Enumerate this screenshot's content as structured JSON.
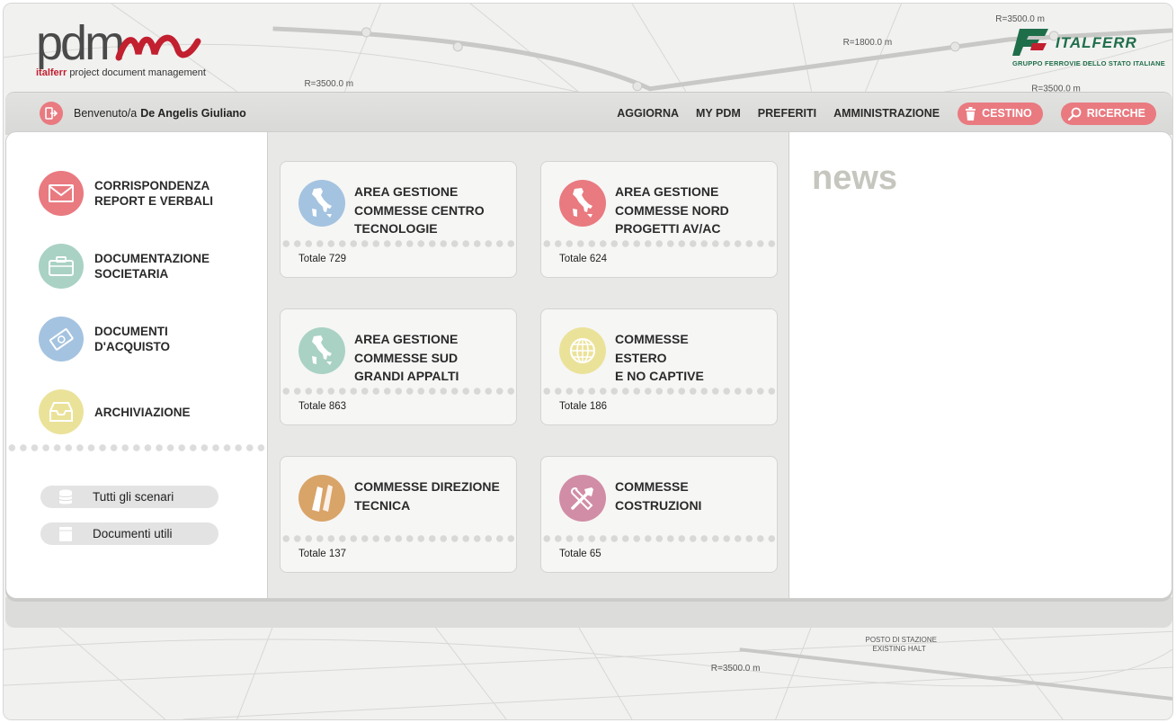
{
  "header": {
    "logo_text": "pdm",
    "logo_brand": "italferr",
    "logo_subtitle": "project document management",
    "company_name": "ITALFERR",
    "company_subtitle": "GRUPPO FERROVIE DELLO STATO ITALIANE"
  },
  "topbar": {
    "welcome_prefix": "Benvenuto/a",
    "user_name": "De Angelis Giuliano",
    "nav": [
      "AGGIORNA",
      "MY PDM",
      "PREFERITI",
      "AMMINISTRAZIONE"
    ],
    "trash_label": "CESTINO",
    "search_label": "RICERCHE"
  },
  "sidebar": {
    "categories": [
      {
        "label": "CORRISPONDENZA\nREPORT E VERBALI",
        "icon": "envelope-icon",
        "color": "#e97a80"
      },
      {
        "label": "DOCUMENTAZIONE\nSOCIETARIA",
        "icon": "briefcase-icon",
        "color": "#a9d2c4"
      },
      {
        "label": "DOCUMENTI\nD'ACQUISTO",
        "icon": "banknote-icon",
        "color": "#a4c3e0"
      },
      {
        "label": "ARCHIVIAZIONE",
        "icon": "inbox-tray-icon",
        "color": "#ebe29a"
      }
    ],
    "buttons": [
      "Tutti gli scenari",
      "Documenti utili"
    ]
  },
  "areas": [
    {
      "title": "AREA GESTIONE\nCOMMESSE CENTRO\nTECNOLOGIE",
      "total": "Totale 729",
      "icon": "italy-map-icon",
      "color": "#a4c3e0"
    },
    {
      "title": "AREA GESTIONE\nCOMMESSE NORD\nPROGETTI AV/AC",
      "total": "Totale 624",
      "icon": "italy-map-icon",
      "color": "#e97a80"
    },
    {
      "title": "AREA GESTIONE\nCOMMESSE SUD\nGRANDI APPALTI",
      "total": "Totale 863",
      "icon": "italy-map-icon",
      "color": "#a9d2c4"
    },
    {
      "title": "COMMESSE\nESTERO\nE NO CAPTIVE",
      "total": "Totale 186",
      "icon": "globe-icon",
      "color": "#ebe29a"
    },
    {
      "title": "COMMESSE DIREZIONE\nTECNICA",
      "total": "Totale 137",
      "icon": "ruler-pencil-icon",
      "color": "#d9a468"
    },
    {
      "title": "COMMESSE\nCOSTRUZIONI",
      "total": "Totale 65",
      "icon": "tools-icon",
      "color": "#d18da6"
    }
  ],
  "news": {
    "title": "news"
  },
  "map_labels": [
    "R=3500.0 m",
    "R=1800.0 m",
    "R=3500.0 m",
    "R=3500.0 m",
    "R=3500.0 m",
    "POSTO DI STAZIONE",
    "EXISTING HALT"
  ]
}
